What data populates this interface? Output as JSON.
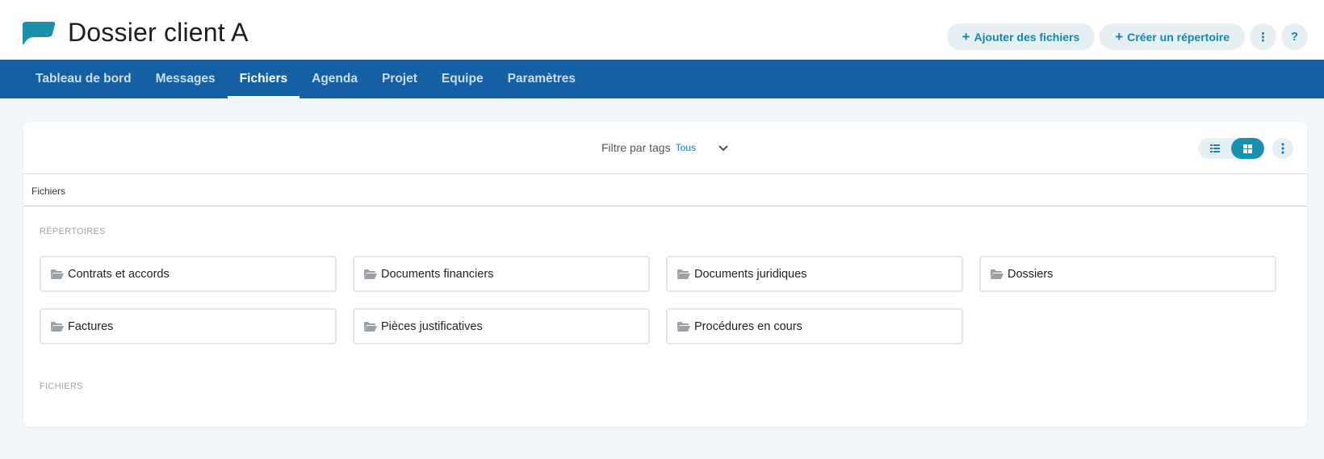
{
  "header": {
    "title": "Dossier client A",
    "logo_icon": "speech-bubble-logo",
    "brand_color": "#1a8fab",
    "actions": {
      "add_files": "Ajouter des fichiers",
      "create_folder": "Créer un répertoire",
      "more": "⋮",
      "help": "?"
    }
  },
  "nav": {
    "tabs": [
      {
        "label": "Tableau de bord",
        "active": false
      },
      {
        "label": "Messages",
        "active": false
      },
      {
        "label": "Fichiers",
        "active": true
      },
      {
        "label": "Agenda",
        "active": false
      },
      {
        "label": "Projet",
        "active": false
      },
      {
        "label": "Equipe",
        "active": false
      },
      {
        "label": "Paramètres",
        "active": false
      }
    ],
    "background": "#1560a4"
  },
  "toolbar": {
    "filter_label": "Filtre par tags",
    "filter_value": "Tous",
    "view_options": [
      "list-view-icon",
      "grid-view-icon"
    ],
    "active_view": "grid-view-icon"
  },
  "breadcrumb": "Fichiers",
  "sections": {
    "folders_title": "RÉPERTOIRES",
    "files_title": "FICHIERS"
  },
  "folders": [
    "Contrats et accords",
    "Documents financiers",
    "Documents juridiques",
    "Dossiers",
    "Factures",
    "Pièces justificatives",
    "Procédures en cours"
  ]
}
